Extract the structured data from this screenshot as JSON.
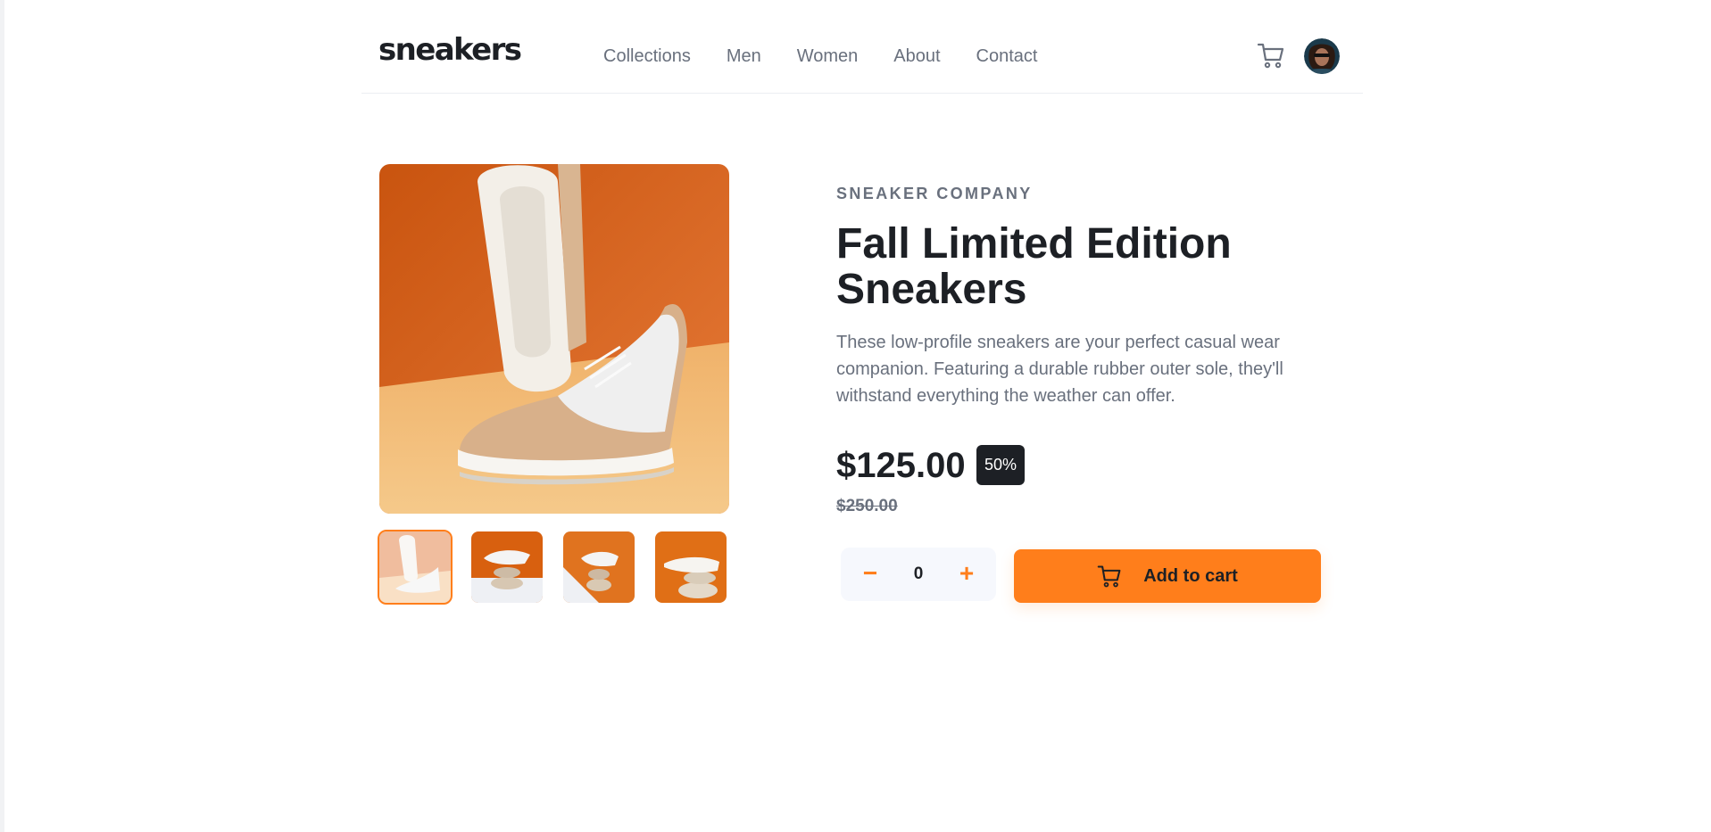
{
  "brand": {
    "logo_text": "sneakers"
  },
  "nav": {
    "items": [
      {
        "label": "Collections"
      },
      {
        "label": "Men"
      },
      {
        "label": "Women"
      },
      {
        "label": "About"
      },
      {
        "label": "Contact"
      }
    ]
  },
  "header_icons": {
    "cart": "cart-icon",
    "avatar": "user-avatar"
  },
  "gallery": {
    "main_image": "white sneaker on orange background",
    "thumbnails": [
      {
        "name": "thumbnail-1",
        "active": true
      },
      {
        "name": "thumbnail-2",
        "active": false
      },
      {
        "name": "thumbnail-3",
        "active": false
      },
      {
        "name": "thumbnail-4",
        "active": false
      }
    ]
  },
  "product": {
    "company": "SNEAKER COMPANY",
    "title": "Fall Limited Edition Sneakers",
    "description": "These low-profile sneakers are your perfect casual wear companion. Featuring a durable rubber outer sole, they'll withstand everything the weather can offer.",
    "price": "$125.00",
    "discount": "50%",
    "old_price": "$250.00"
  },
  "quantity": {
    "minus": "−",
    "value": "0",
    "plus": "+"
  },
  "add_to_cart": {
    "label": "Add to cart"
  },
  "colors": {
    "accent": "#ff7e1b",
    "text_dark": "#1d2025",
    "text_muted": "#69707d",
    "qty_bg": "#f6f8fd"
  }
}
